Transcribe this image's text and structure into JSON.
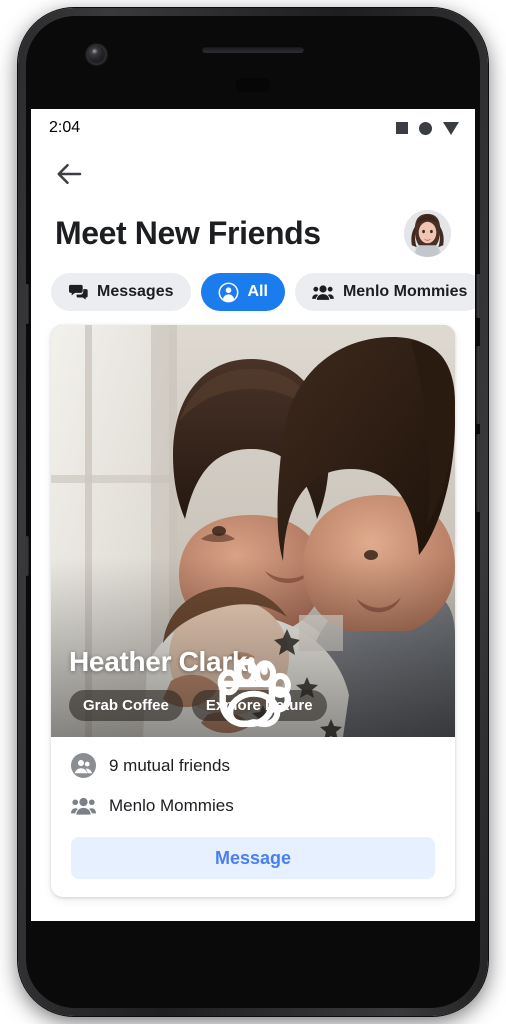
{
  "status_bar": {
    "time": "2:04",
    "icons": [
      "square-icon",
      "circle-icon",
      "triangle-down-icon"
    ]
  },
  "nav": {
    "back_icon": "back-arrow-icon"
  },
  "header": {
    "title": "Meet New Friends",
    "avatar": "user-avatar"
  },
  "filter_chips": [
    {
      "label": "Messages",
      "icon": "chat-bubbles-icon",
      "active": false
    },
    {
      "label": "All",
      "icon": "person-circle-icon",
      "active": true
    },
    {
      "label": "Menlo Mommies",
      "icon": "group-icon",
      "active": false
    }
  ],
  "profile_card": {
    "name": "Heather Clark",
    "photo_alt": "couple-holding-newborn-baby",
    "tags": [
      {
        "label": "Grab Coffee",
        "icon": "coffee-cup-icon"
      },
      {
        "label": "Explore Nature",
        "icon": "paw-print-icon"
      }
    ],
    "mutual_friends": "9 mutual friends",
    "mutual_friends_icon": "friends-circle-icon",
    "group": "Menlo Mommies",
    "group_icon": "group-icon",
    "message_button": "Message"
  },
  "colors": {
    "accent_blue": "#1b7ced",
    "message_text": "#4a7ff0",
    "message_bg": "#e7f0fe",
    "chip_bg": "#ebedf0",
    "text_primary": "#1c1e21"
  }
}
